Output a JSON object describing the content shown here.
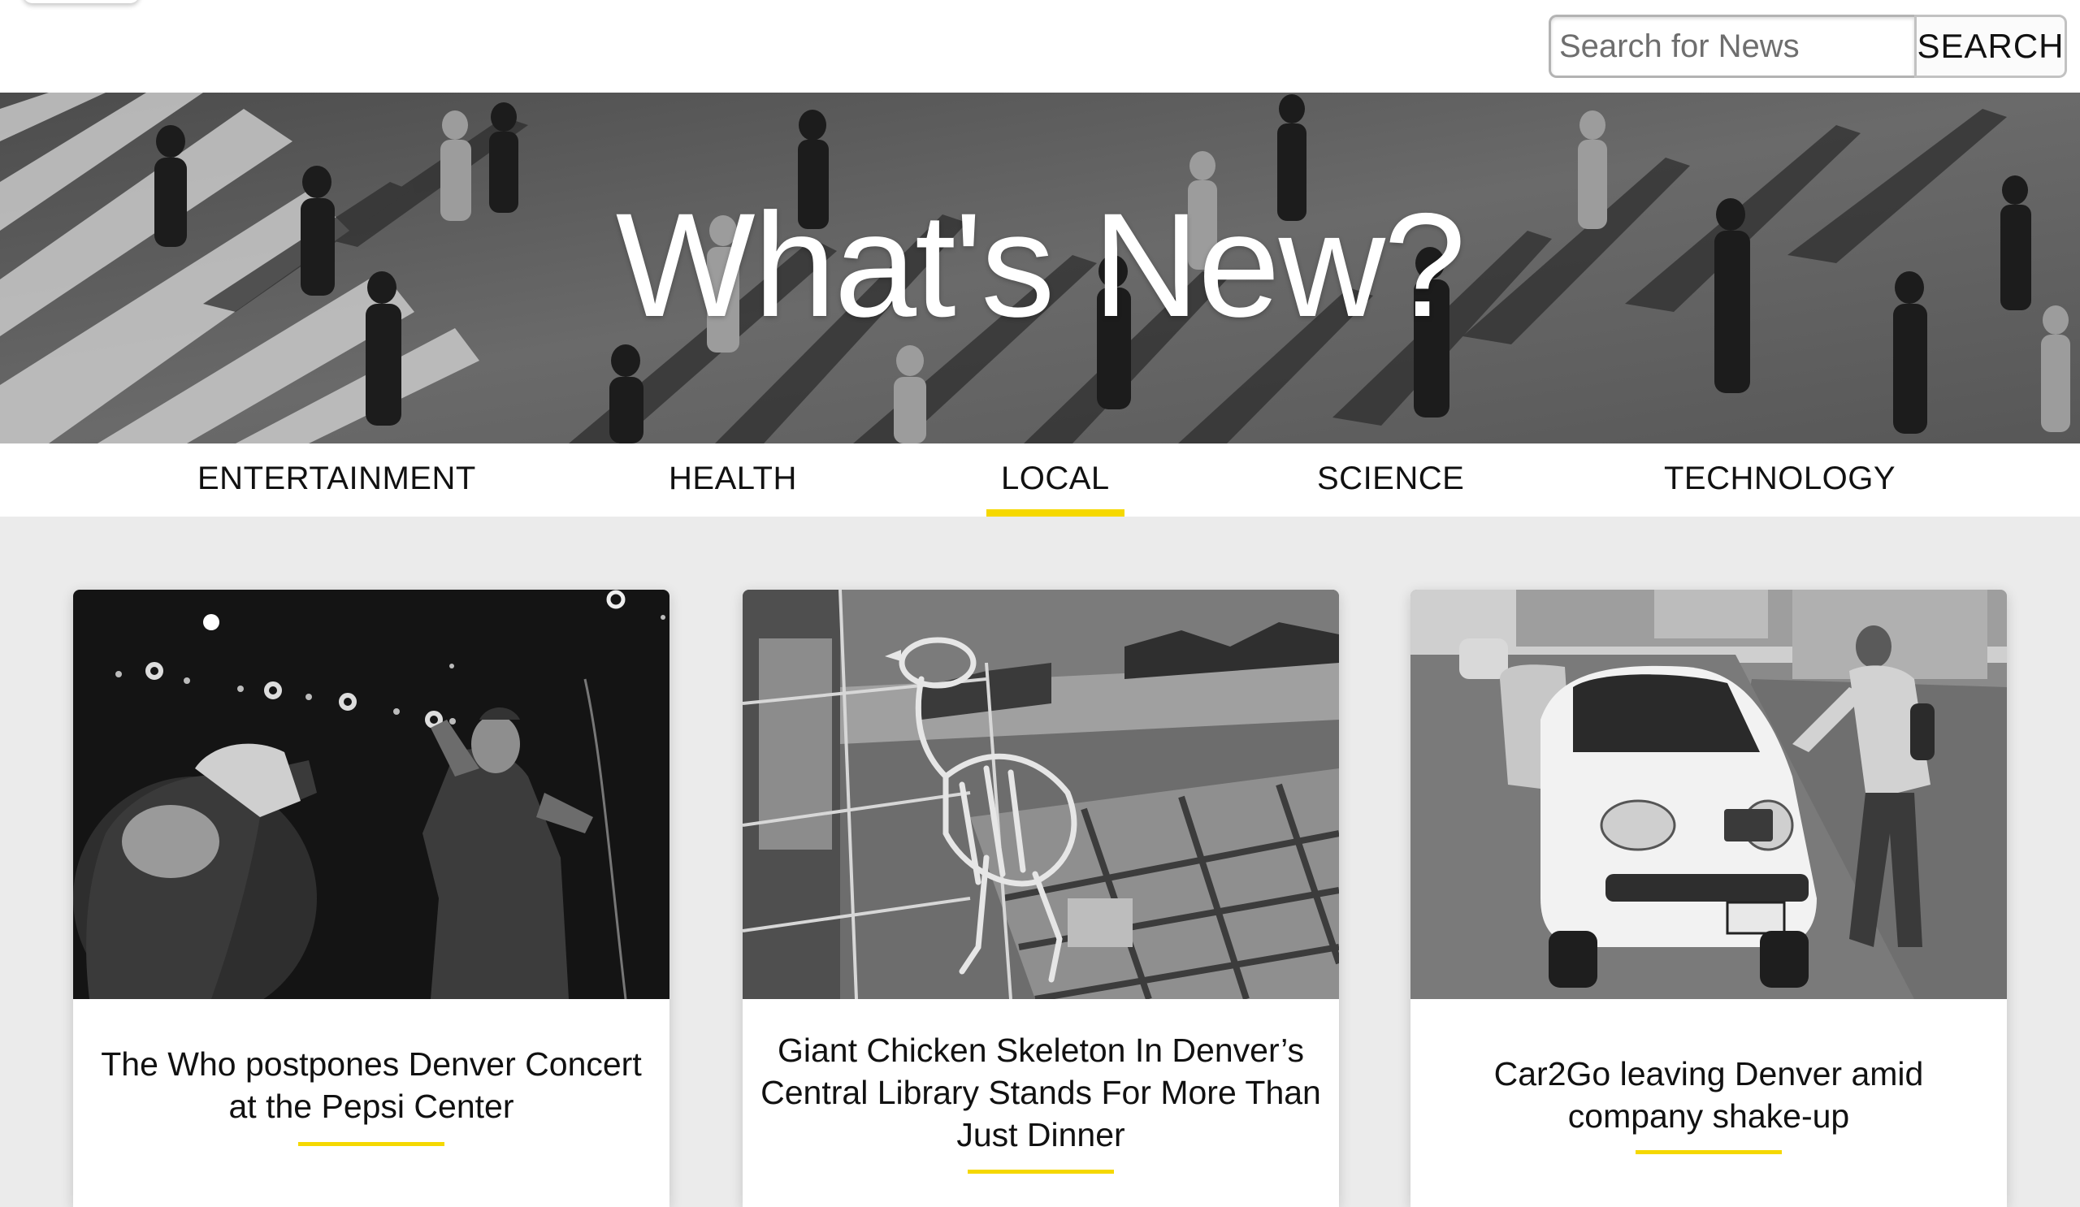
{
  "search": {
    "placeholder": "Search for News",
    "button_label": "SEARCH"
  },
  "hero": {
    "title": "What's New?"
  },
  "nav": {
    "items": [
      {
        "label": "ENTERTAINMENT",
        "active": false
      },
      {
        "label": "HEALTH",
        "active": false
      },
      {
        "label": "LOCAL",
        "active": true
      },
      {
        "label": "SCIENCE",
        "active": false
      },
      {
        "label": "TECHNOLOGY",
        "active": false
      }
    ]
  },
  "articles": [
    {
      "title": "The Who postpones Denver Concert at the Pepsi Center",
      "image": "concert-photo"
    },
    {
      "title": "Giant Chicken Skeleton In Denver’s Central Library Stands For More Than Just Dinner",
      "image": "library-skeleton-photo"
    },
    {
      "title": "Car2Go leaving Denver amid company shake-up",
      "image": "car2go-photo"
    }
  ],
  "colors": {
    "accent": "#f5d800",
    "page_background": "#ebebeb",
    "header_background": "#ffffff",
    "text": "#111111"
  }
}
